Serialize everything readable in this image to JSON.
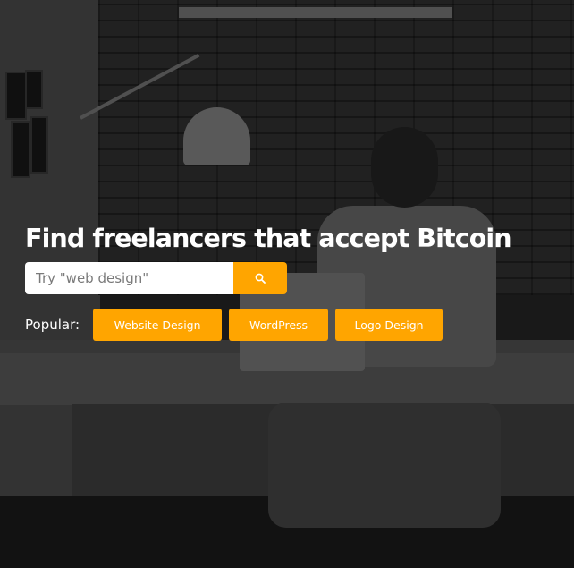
{
  "hero": {
    "headline": "Find freelancers that accept Bitcoin",
    "search": {
      "placeholder": "Try \"web design\"",
      "value": "",
      "button_icon": "search-icon"
    },
    "popular": {
      "label": "Popular:",
      "tags": [
        "Website Design",
        "WordPress",
        "Logo Design"
      ]
    }
  },
  "colors": {
    "accent": "#ffa500",
    "text": "#ffffff",
    "input_bg": "#ffffff"
  }
}
